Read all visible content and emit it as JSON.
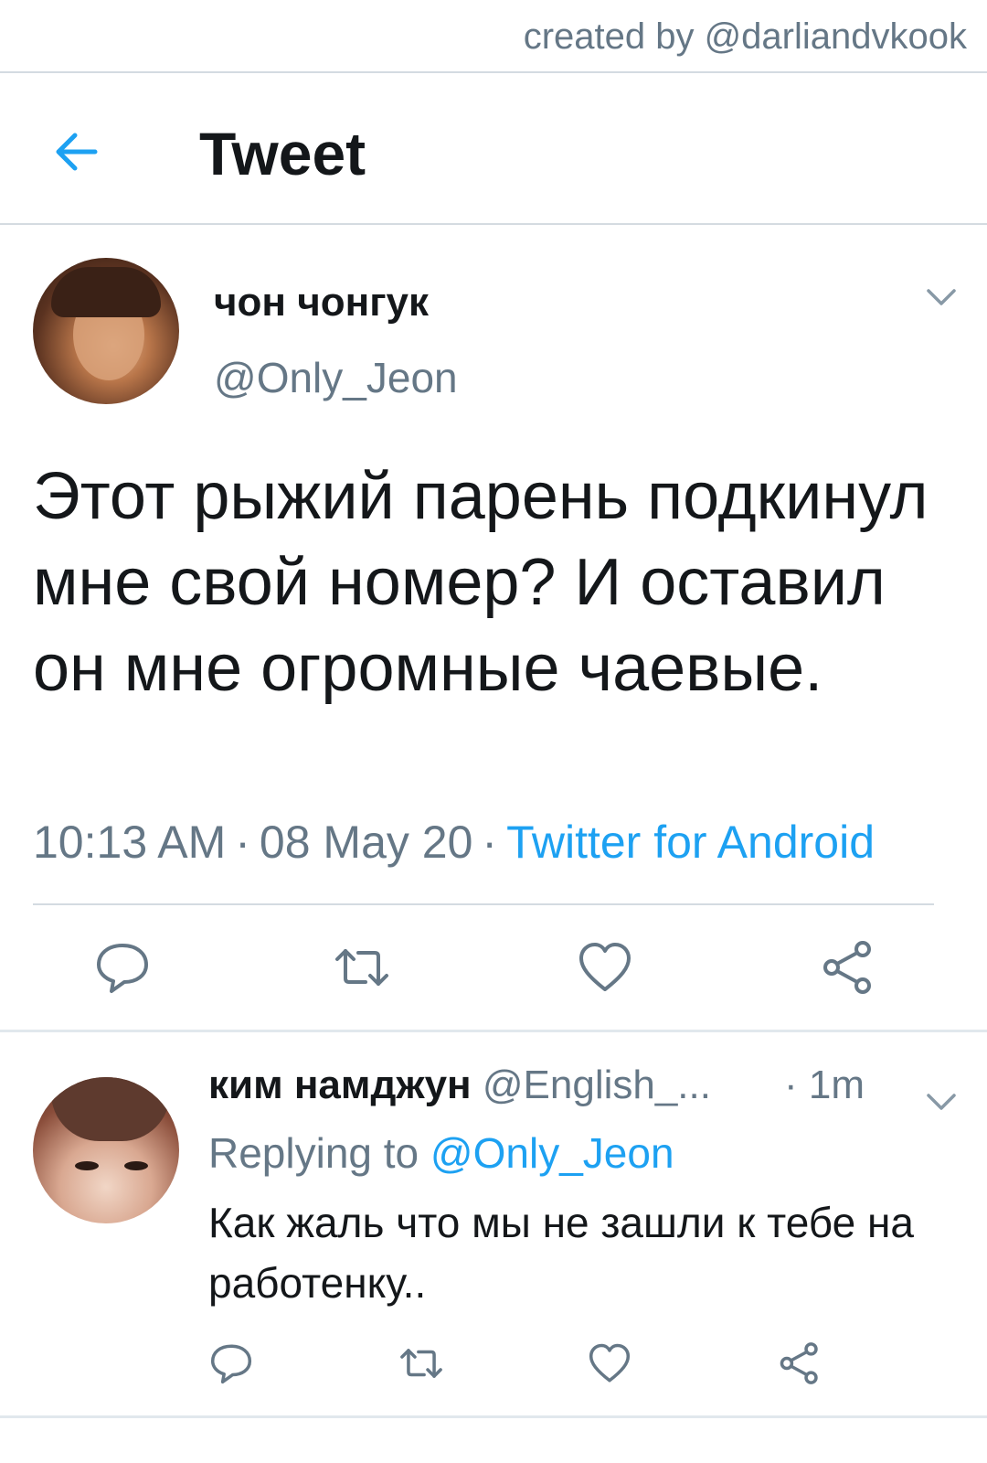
{
  "watermark": "created by @darliandvkook",
  "header": {
    "title": "Tweet",
    "back_icon": "arrow-left-icon"
  },
  "colors": {
    "accent": "#1da1f2",
    "secondary_text": "#657786",
    "primary_text": "#14171a",
    "divider": "#d4dbe1"
  },
  "tweet": {
    "author_name": "чон чонгук",
    "author_handle": "@Only_Jeon",
    "text": "Этот рыжий парень подкинул мне свой номер? И оставил он мне огромные чаевые.",
    "time": "10:13 AM",
    "date": "08 May 20",
    "source": "Twitter for Android",
    "separator": "·",
    "actions": [
      "reply-icon",
      "retweet-icon",
      "like-icon",
      "share-icon"
    ]
  },
  "reply": {
    "author_name": "ким намджун",
    "author_handle": "@English_...",
    "time": "· 1m",
    "replying_prefix": "Replying to",
    "replying_to": "@Only_Jeon",
    "text": "Как жаль что мы не зашли к тебе на работенку..",
    "actions": [
      "reply-icon",
      "retweet-icon",
      "like-icon",
      "share-icon"
    ]
  }
}
